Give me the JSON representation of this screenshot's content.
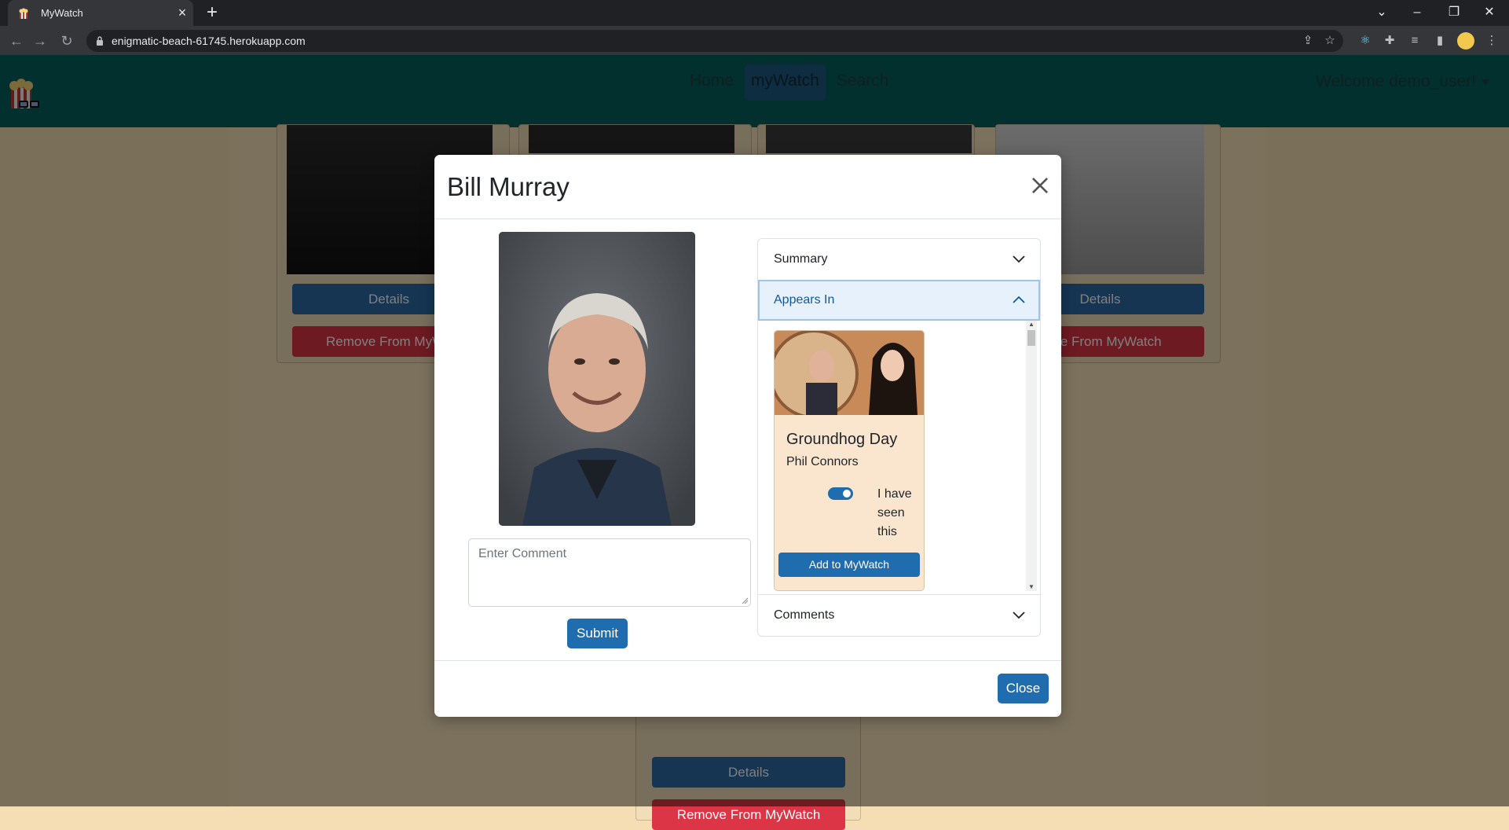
{
  "browser": {
    "tab_title": "MyWatch",
    "url": "enigmatic-beach-61745.herokuapp.com"
  },
  "navbar": {
    "links": [
      "Home",
      "myWatch",
      "Search"
    ],
    "active": "myWatch",
    "welcome": "Welcome demo_user!"
  },
  "background_cards": {
    "details_label": "Details",
    "remove_label": "Remove From MyWatch",
    "remove_label_left_clipped": "Remove From MyWa",
    "remove_label_right_clipped": "nove From MyWatch"
  },
  "modal": {
    "title": "Bill Murray",
    "comment_placeholder": "Enter Comment",
    "submit_label": "Submit",
    "close_label": "Close",
    "accordion": {
      "summary_label": "Summary",
      "appears_in_label": "Appears In",
      "comments_label": "Comments"
    },
    "movie": {
      "title": "Groundhog Day",
      "role": "Phil Connors",
      "seen_label": "I have seen this",
      "seen": true,
      "add_label": "Add to MyWatch"
    }
  },
  "colors": {
    "navbar": "#04615f",
    "primary": "#1f6cae",
    "danger": "#dc3545",
    "page_bg": "#f7e2bb"
  }
}
